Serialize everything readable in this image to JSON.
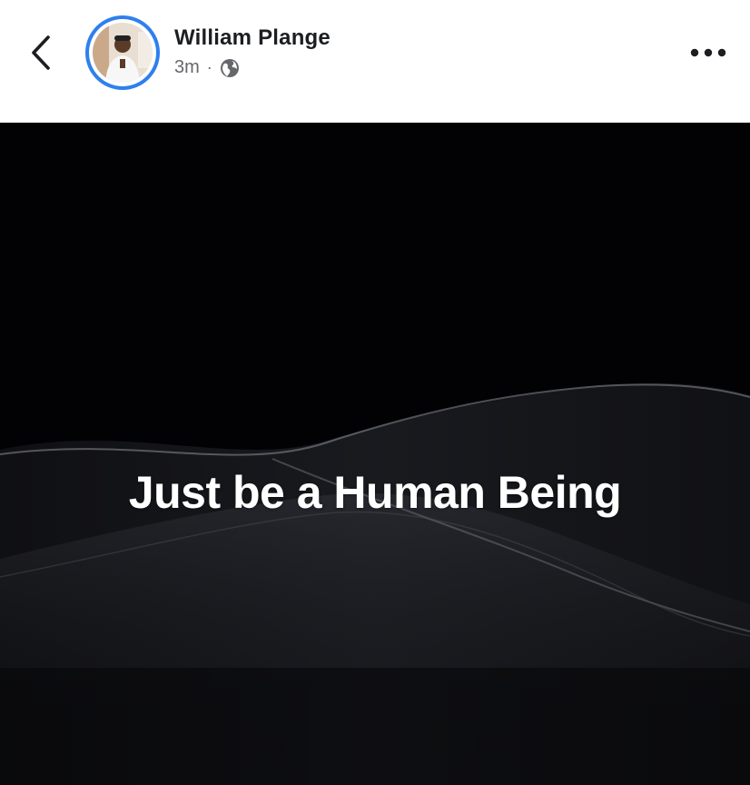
{
  "header": {
    "author_name": "William Plange",
    "timestamp": "3m",
    "separator": "·",
    "privacy_icon": "globe-icon",
    "back_icon": "chevron-left-icon",
    "more_icon": "more-horizontal-icon",
    "avatar_ring_color": "#2f80ed"
  },
  "post": {
    "text": "Just be a Human Being",
    "background_color": "#020204",
    "text_color": "#ffffff"
  }
}
